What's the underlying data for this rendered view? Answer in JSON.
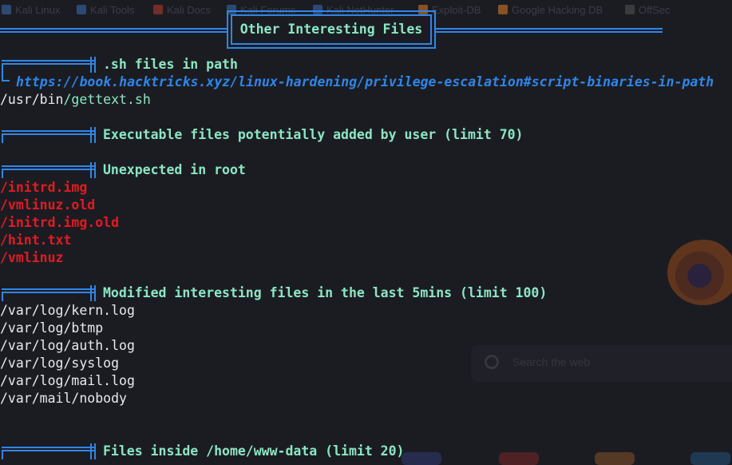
{
  "browser_bookmarks": [
    {
      "label": "Kali Linux",
      "color": "#3b6fb6"
    },
    {
      "label": "Kali Tools",
      "color": "#3b6fb6"
    },
    {
      "label": "Kali Docs",
      "color": "#c0392b"
    },
    {
      "label": "Kali Forums",
      "color": "#3b6fb6"
    },
    {
      "label": "Kali NetHunter",
      "color": "#3b6fb6"
    },
    {
      "label": "Exploit-DB",
      "color": "#e67e22"
    },
    {
      "label": "Google Hacking DB",
      "color": "#e67e22"
    },
    {
      "label": "OffSec",
      "color": "#555555"
    }
  ],
  "browser_search_placeholder": "Search the web",
  "banner": {
    "title": "Other Interesting Files"
  },
  "sections": {
    "sh_files": {
      "title": ".sh files in path",
      "link": "https://book.hacktricks.xyz/linux-hardening/privilege-escalation#script-binaries-in-path",
      "entry_dir": "/usr/bin",
      "entry_file": "/gettext.sh"
    },
    "executable_files": {
      "title": "Executable files potentially added by user (limit 70)"
    },
    "unexpected_root": {
      "title": "Unexpected in root",
      "items": [
        "/initrd.img",
        "/vmlinuz.old",
        "/initrd.img.old",
        "/hint.txt",
        "/vmlinuz"
      ]
    },
    "modified_files": {
      "title": "Modified interesting files in the last 5mins (limit 100)",
      "items": [
        "/var/log/kern.log",
        "/var/log/btmp",
        "/var/log/auth.log",
        "/var/log/syslog",
        "/var/log/mail.log",
        "/var/mail/nobody"
      ]
    },
    "home_files": {
      "title": "Files inside /home/www-data (limit 20)"
    }
  },
  "colors": {
    "background": "#1b1c22",
    "text": "#e9e9ec",
    "header": "#8ce6c3",
    "highlight_red": "#e01b24",
    "link_blue": "#2f86e8"
  }
}
